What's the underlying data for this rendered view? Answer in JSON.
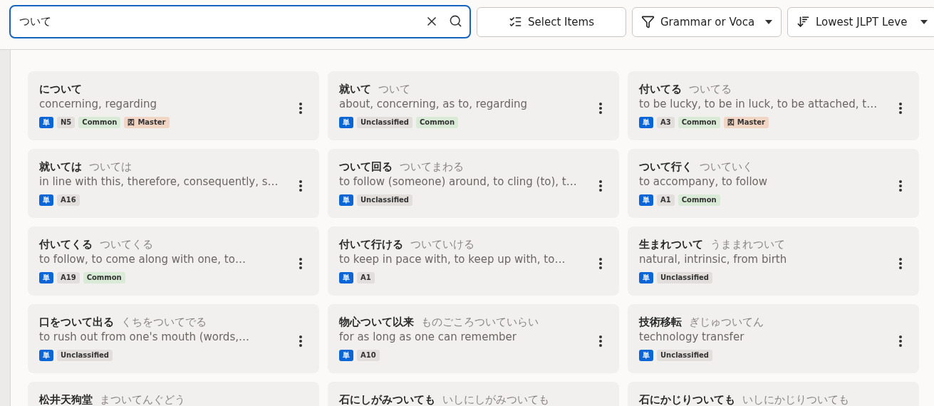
{
  "search": {
    "value": "ついて"
  },
  "toolbar": [
    {
      "kind": "select",
      "label": "Select Items"
    },
    {
      "kind": "filter",
      "label": "Grammar or Voca"
    },
    {
      "kind": "sort",
      "label": "Lowest JLPT Leve"
    }
  ],
  "cards": [
    {
      "title": "について",
      "meaning": "concerning, regarding",
      "tags": [
        {
          "kind": "type",
          "label": "単"
        },
        {
          "kind": "level",
          "label": "N5"
        },
        {
          "kind": "common",
          "label": "Common"
        },
        {
          "kind": "master",
          "label": "Master",
          "icon": "図"
        }
      ]
    },
    {
      "title": "就いて",
      "reading": "ついて",
      "meaning": "about, concerning, as to, regarding",
      "tags": [
        {
          "kind": "type",
          "label": "単"
        },
        {
          "kind": "level",
          "label": "Unclassified"
        },
        {
          "kind": "common",
          "label": "Common"
        }
      ]
    },
    {
      "title": "付いてる",
      "reading": "ついてる",
      "meaning": "to be lucky, to be in luck, to be attached, t…",
      "tags": [
        {
          "kind": "type",
          "label": "単"
        },
        {
          "kind": "level",
          "label": "A3"
        },
        {
          "kind": "common",
          "label": "Common"
        },
        {
          "kind": "master",
          "label": "Master",
          "icon": "図"
        }
      ]
    },
    {
      "title": "就いては",
      "reading": "ついては",
      "meaning": "in line with this, therefore, consequently, s…",
      "tags": [
        {
          "kind": "type",
          "label": "単"
        },
        {
          "kind": "level",
          "label": "A16"
        }
      ]
    },
    {
      "title": "ついて回る",
      "reading": "ついてまわる",
      "meaning": "to follow (someone) around, to cling (to), t…",
      "tags": [
        {
          "kind": "type",
          "label": "単"
        },
        {
          "kind": "level",
          "label": "Unclassified"
        }
      ]
    },
    {
      "title": "ついて行く",
      "reading": "ついていく",
      "meaning": "to accompany, to follow",
      "tags": [
        {
          "kind": "type",
          "label": "単"
        },
        {
          "kind": "level",
          "label": "A1"
        },
        {
          "kind": "common",
          "label": "Common"
        }
      ]
    },
    {
      "title": "付いてくる",
      "reading": "ついてくる",
      "meaning": "to follow, to come along with one, to…",
      "tags": [
        {
          "kind": "type",
          "label": "単"
        },
        {
          "kind": "level",
          "label": "A19"
        },
        {
          "kind": "common",
          "label": "Common"
        }
      ]
    },
    {
      "title": "付いて行ける",
      "reading": "ついていける",
      "meaning": "to keep in pace with, to keep up with, to…",
      "tags": [
        {
          "kind": "type",
          "label": "単"
        },
        {
          "kind": "level",
          "label": "A1"
        }
      ]
    },
    {
      "title": "生まれついて",
      "reading": "うままれついて",
      "meaning": "natural, intrinsic, from birth",
      "tags": [
        {
          "kind": "type",
          "label": "単"
        },
        {
          "kind": "level",
          "label": "Unclassified"
        }
      ]
    },
    {
      "title": "口をついて出る",
      "reading": "くちをついてでる",
      "meaning": "to rush out from one's mouth (words,…",
      "tags": [
        {
          "kind": "type",
          "label": "単"
        },
        {
          "kind": "level",
          "label": "Unclassified"
        }
      ]
    },
    {
      "title": "物心ついて以来",
      "reading": "ものごころついていらい",
      "meaning": "for as long as one can remember",
      "tags": [
        {
          "kind": "type",
          "label": "単"
        },
        {
          "kind": "level",
          "label": "A10"
        }
      ]
    },
    {
      "title": "技術移転",
      "reading": "ぎじゅついてん",
      "meaning": "technology transfer",
      "tags": [
        {
          "kind": "type",
          "label": "単"
        },
        {
          "kind": "level",
          "label": "Unclassified"
        }
      ]
    },
    {
      "title": "松井天狗堂",
      "reading": "まついてんぐどう"
    },
    {
      "title": "石にしがみついても",
      "reading": "いしにしがみついても"
    },
    {
      "title": "石にかじりついても",
      "reading": "いしにかじりついても"
    }
  ]
}
